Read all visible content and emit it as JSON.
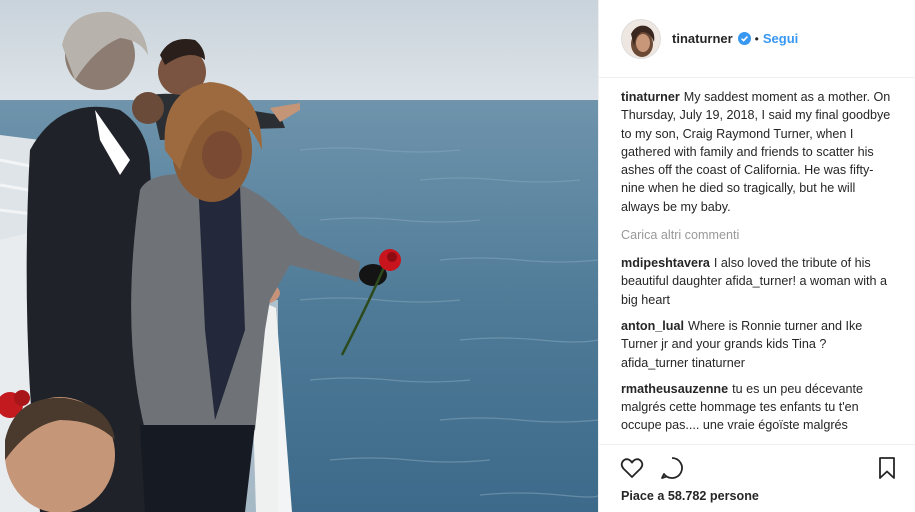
{
  "post": {
    "author": "tinaturner",
    "follow_label": "Segui",
    "separator": "•",
    "caption_user": "tinaturner",
    "caption": "My saddest moment as a mother. On Thursday, July 19, 2018, I said my final goodbye to my son, Craig Raymond Turner, when I gathered with family and friends to scatter his ashes off the coast of California. He was fifty-nine when he died so tragically, but he will always be my baby.",
    "load_more": "Carica altri commenti",
    "likes_text": "Piace a 58.782 persone"
  },
  "comments": [
    {
      "user": "mdipeshtavera",
      "text": "I also loved the tribute of his beautiful daughter afida_turner! a woman with a big heart"
    },
    {
      "user": "anton_lual",
      "text": "Where is Ronnie turner and Ike Turner jr and your grands kids Tina ? afida_turner tinaturner"
    },
    {
      "user": "rmatheusauzenne",
      "text": "tu es un peu décevante malgrés cette hommage tes enfants tu t'en occupe pas.... une vraie égoïste malgrés"
    }
  ],
  "icons": {
    "like": "heart-icon",
    "comment": "comment-bubble-icon",
    "save": "bookmark-icon",
    "verified": "verified-badge-icon"
  },
  "colors": {
    "link": "#3897f0",
    "text": "#262626",
    "muted": "#999999",
    "border": "#efefef"
  }
}
